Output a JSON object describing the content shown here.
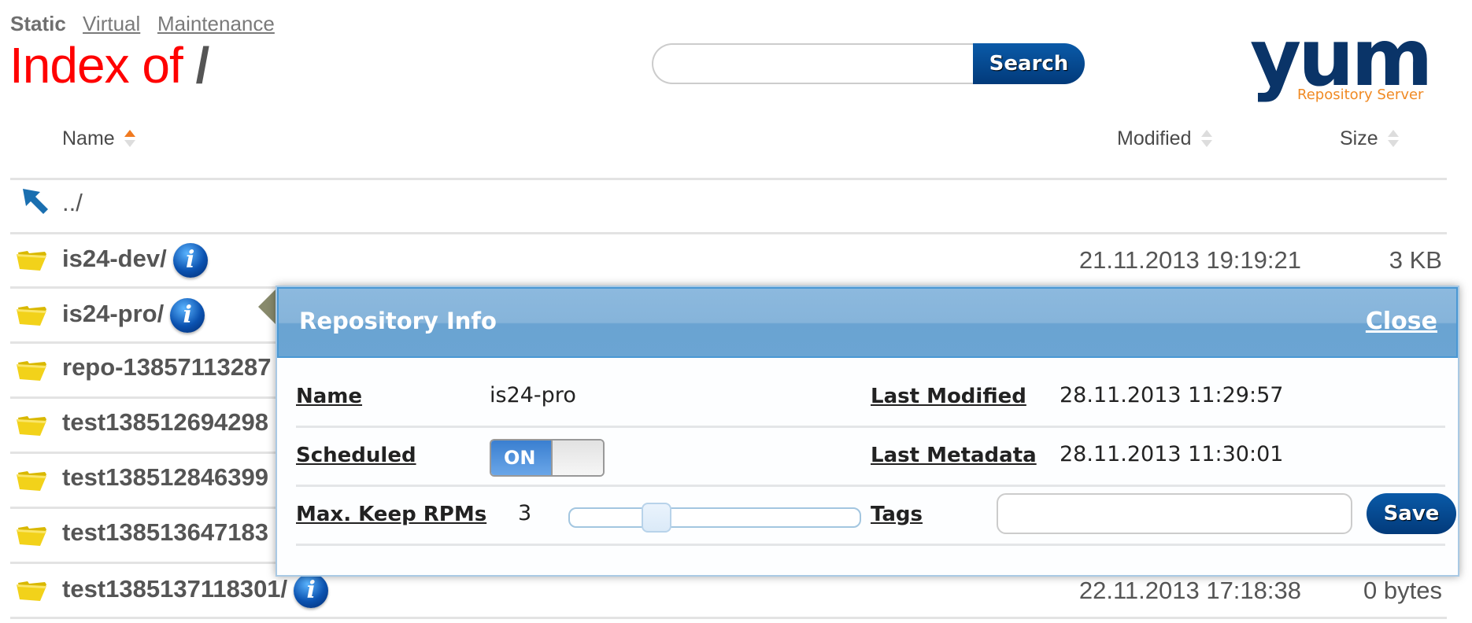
{
  "nav": {
    "items": [
      {
        "label": "Static",
        "active": true
      },
      {
        "label": "Virtual",
        "active": false
      },
      {
        "label": "Maintenance",
        "active": false
      }
    ]
  },
  "title": {
    "prefix": "Index of",
    "path": "/"
  },
  "search": {
    "value": "",
    "placeholder": "",
    "button_label": "Search"
  },
  "logo": {
    "main": "yum",
    "sub": "Repository Server"
  },
  "table": {
    "columns": [
      {
        "label": "Name",
        "sort": "ascending",
        "icon": "sort-icon"
      },
      {
        "label": "Modified",
        "sort": "none",
        "icon": "sort-icon"
      },
      {
        "label": "Size",
        "sort": "none",
        "icon": "sort-icon"
      }
    ],
    "rows": [
      {
        "icon": "parent-directory-arrow-icon",
        "name": "../",
        "modified": "",
        "size": "",
        "info": false
      },
      {
        "icon": "folder-icon",
        "name": "is24-dev/",
        "modified": "21.11.2013 19:19:21",
        "size": "3 KB",
        "info": true
      },
      {
        "icon": "folder-icon",
        "name": "is24-pro/",
        "modified": "",
        "size": "",
        "info": true
      },
      {
        "icon": "folder-icon",
        "name": "repo-13857113287",
        "modified": "",
        "size": "",
        "info": false
      },
      {
        "icon": "folder-icon",
        "name": "test138512694298",
        "modified": "",
        "size": "",
        "info": false
      },
      {
        "icon": "folder-icon",
        "name": "test138512846399",
        "modified": "",
        "size": "",
        "info": false
      },
      {
        "icon": "folder-icon",
        "name": "test138513647183",
        "modified": "",
        "size": "",
        "info": false
      },
      {
        "icon": "folder-icon",
        "name": "test1385137118301/",
        "modified": "22.11.2013 17:18:38",
        "size": "0 bytes",
        "info": true
      }
    ]
  },
  "popup": {
    "title": "Repository Info",
    "close_label": "Close",
    "name_label": "Name",
    "name_value": "is24-pro",
    "last_modified_label": "Last Modified",
    "last_modified_value": "28.11.2013 11:29:57",
    "scheduled_label": "Scheduled",
    "scheduled_state": "ON",
    "last_metadata_label": "Last Metadata",
    "last_metadata_value": "28.11.2013 11:30:01",
    "max_keep_label": "Max. Keep RPMs",
    "max_keep_value": "3",
    "max_keep_slider_fraction": 0.3,
    "tags_label": "Tags",
    "tags_value": "",
    "save_label": "Save"
  }
}
